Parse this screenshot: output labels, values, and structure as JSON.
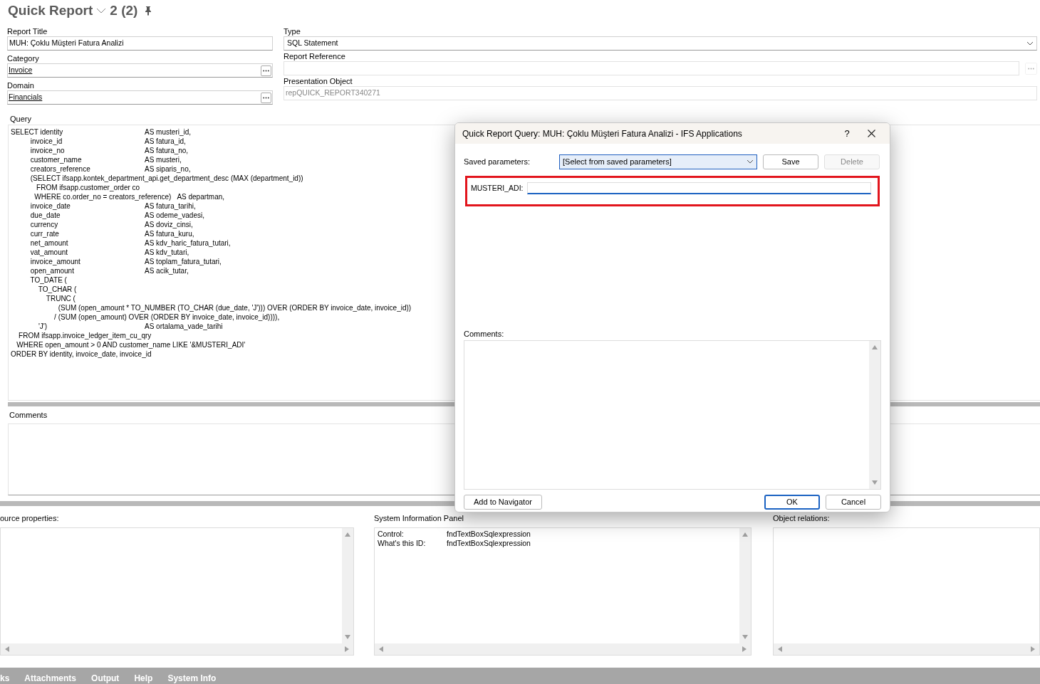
{
  "header": {
    "title": "Quick Report",
    "record": "2 (2)"
  },
  "form": {
    "left": [
      {
        "label": "Report Title",
        "value": "MUH: Çoklu Müşteri Fatura Analizi",
        "kind": "text",
        "disabled": false
      },
      {
        "label": "Category",
        "value": "Invoice",
        "kind": "lov",
        "disabled": false
      },
      {
        "label": "Domain",
        "value": "Financials",
        "kind": "lov",
        "disabled": false
      }
    ],
    "right": [
      {
        "label": "Type",
        "value": "SQL Statement",
        "kind": "select",
        "disabled": false
      },
      {
        "label": "Report Reference",
        "kind": "lov",
        "disabled": true
      },
      {
        "label": "Presentation Object",
        "value": "repQUICK_REPORT340271",
        "kind": "text",
        "disabled": true
      }
    ]
  },
  "query": {
    "label": "Query",
    "lines": [
      {
        "code": "SELECT identity",
        "alias": "AS musteri_id,"
      },
      {
        "code": "          invoice_id",
        "alias": "AS fatura_id,"
      },
      {
        "code": "          invoice_no",
        "alias": "AS fatura_no,"
      },
      {
        "code": "          customer_name",
        "alias": "AS musteri,"
      },
      {
        "code": "          creators_reference",
        "alias": "AS siparis_no,"
      },
      {
        "code": "          (SELECT ifsapp.kontek_department_api.get_department_desc (MAX (department_id))"
      },
      {
        "code": "             FROM ifsapp.customer_order co"
      },
      {
        "code": "            WHERE co.order_no = creators_reference)",
        "alias": "AS departman,"
      },
      {
        "code": "          invoice_date",
        "alias": "AS fatura_tarihi,"
      },
      {
        "code": "          due_date",
        "alias": "AS odeme_vadesi,"
      },
      {
        "code": "          currency",
        "alias": "AS doviz_cinsi,"
      },
      {
        "code": "          curr_rate",
        "alias": "AS fatura_kuru,"
      },
      {
        "code": "          net_amount",
        "alias": "AS kdv_haric_fatura_tutari,"
      },
      {
        "code": "          vat_amount",
        "alias": "AS kdv_tutari,"
      },
      {
        "code": "          invoice_amount",
        "alias": "AS toplam_fatura_tutari,"
      },
      {
        "code": "          open_amount",
        "alias": "AS acik_tutar,"
      },
      {
        "code": "          TO_DATE ("
      },
      {
        "code": "              TO_CHAR ("
      },
      {
        "code": "                  TRUNC ("
      },
      {
        "code": "                        (SUM (open_amount * TO_NUMBER (TO_CHAR (due_date, 'J'))) OVER (ORDER BY invoice_date, invoice_id))"
      },
      {
        "code": "                      / (SUM (open_amount) OVER (ORDER BY invoice_date, invoice_id)))),"
      },
      {
        "code": "              'J')",
        "alias": "AS ortalama_vade_tarihi"
      },
      {
        "code": "    FROM ifsapp.invoice_ledger_item_cu_qry"
      },
      {
        "code": "   WHERE open_amount > 0 AND customer_name LIKE '&MUSTERI_ADI'"
      },
      {
        "code": "ORDER BY identity, invoice_date, invoice_id"
      }
    ]
  },
  "comments": {
    "label": "Comments"
  },
  "panels": [
    {
      "label": "ource properties:"
    },
    {
      "label": "System Information Panel",
      "rows": [
        {
          "key": "Control:",
          "value": "fndTextBoxSqlexpression"
        },
        {
          "key": "What's this ID:",
          "value": "fndTextBoxSqlexpression"
        }
      ]
    },
    {
      "label": "Object relations:"
    }
  ],
  "bottom_tabs": [
    "ks",
    "Attachments",
    "Output",
    "Help",
    "System Info"
  ],
  "dialog": {
    "title": "Quick Report Query: MUH: Çoklu Müşteri Fatura Analizi - IFS Applications",
    "help": "?",
    "saved_label": "Saved parameters:",
    "saved_value": "[Select from saved parameters]",
    "buttons": [
      {
        "label": "Save",
        "disabled": false
      },
      {
        "label": "Delete",
        "disabled": true
      }
    ],
    "parameters": [
      {
        "label": "MUSTERI_ADI:",
        "focused": true,
        "highlighted": true
      }
    ],
    "comments_label": "Comments:",
    "footer_buttons": [
      {
        "label": "Add to Navigator",
        "default": false
      },
      {
        "label": "OK",
        "default": true
      },
      {
        "label": "Cancel",
        "default": false
      }
    ]
  }
}
